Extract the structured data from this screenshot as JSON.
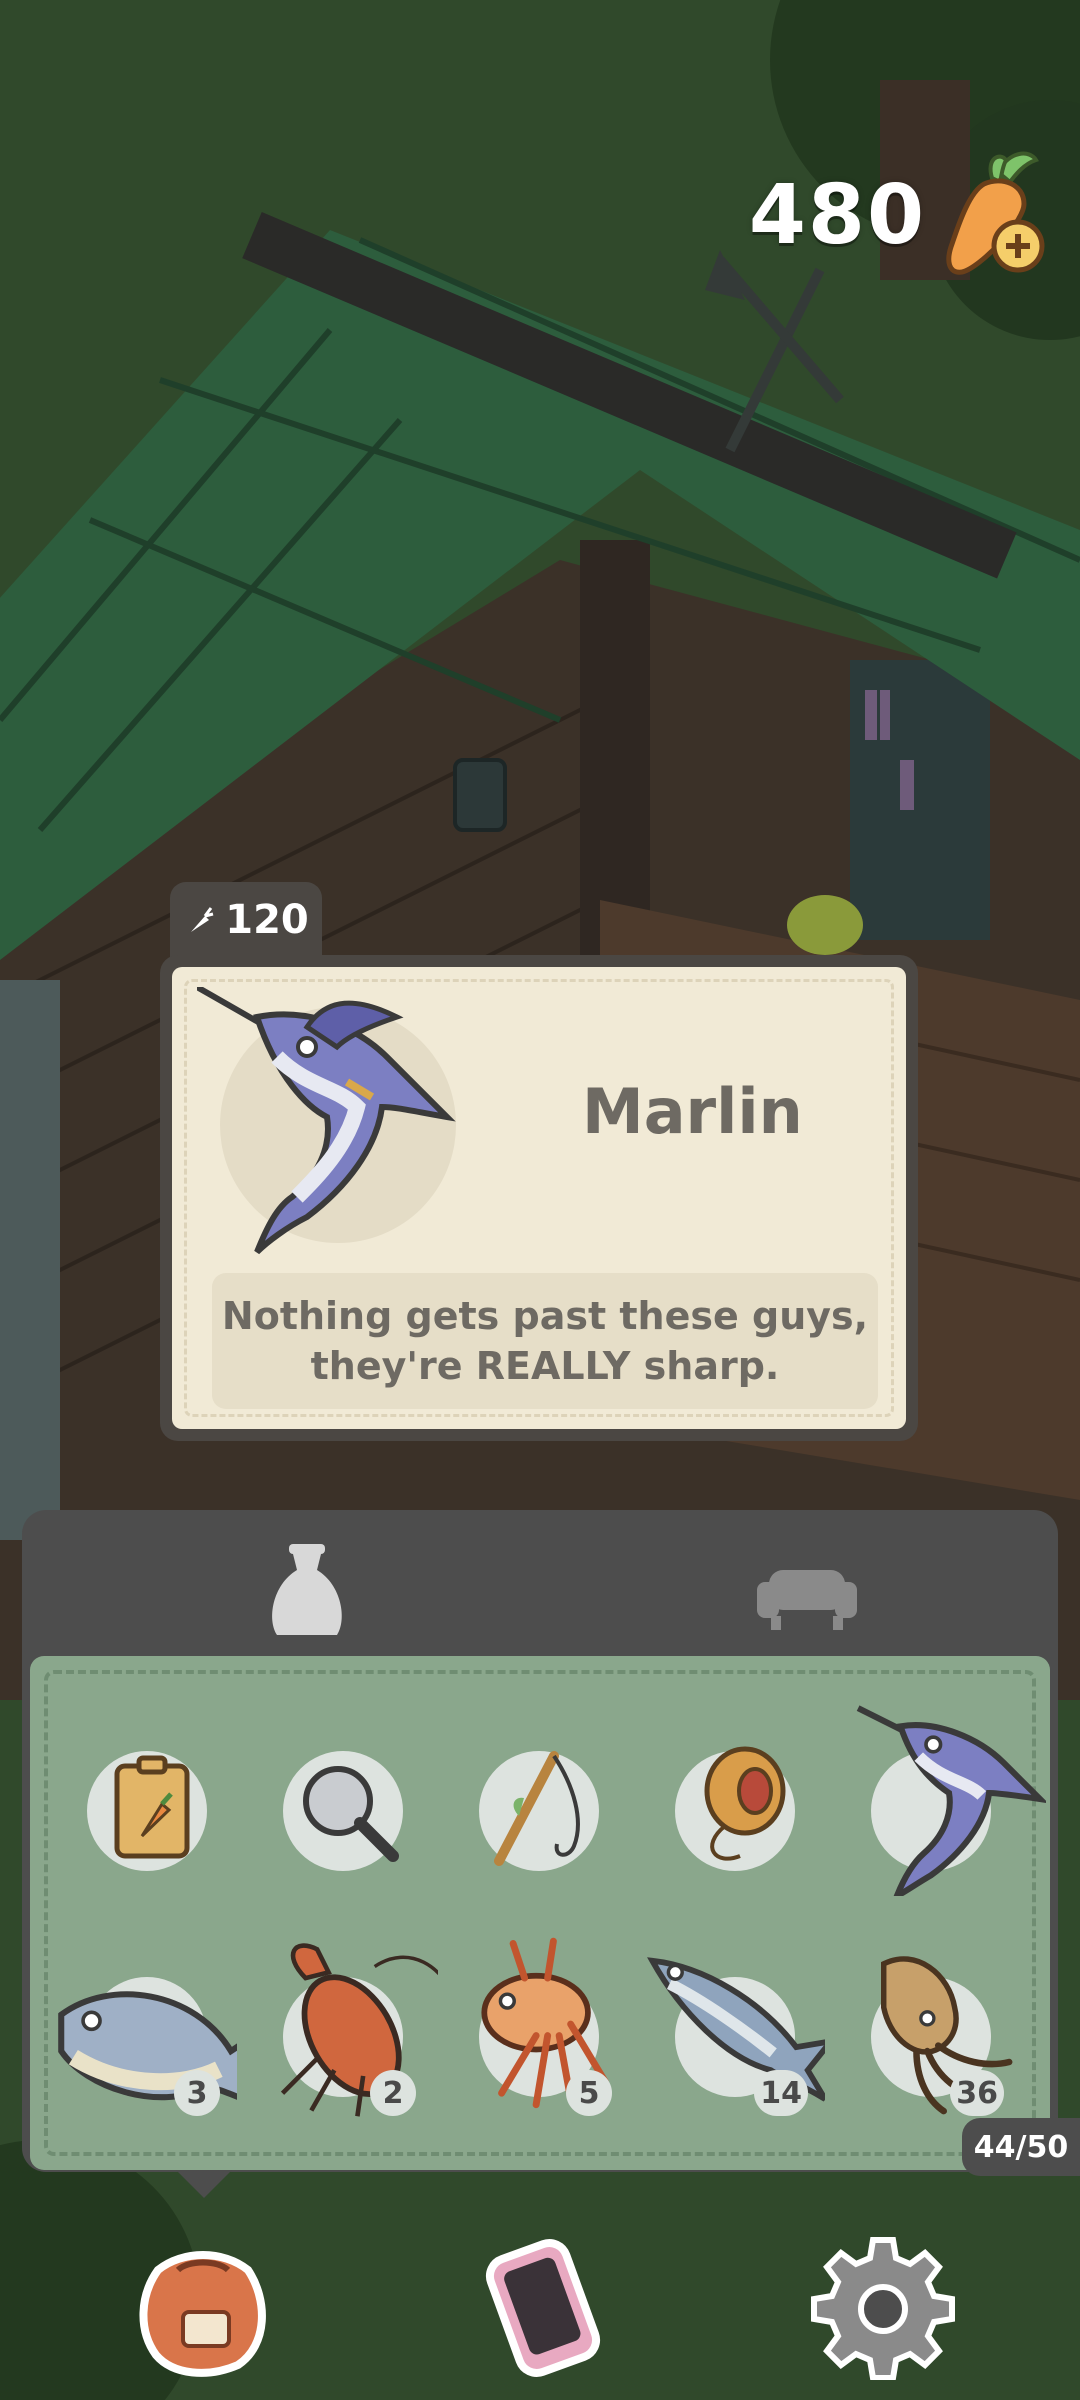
{
  "currency": {
    "amount": "480",
    "icon": "carrot-plus-icon"
  },
  "tooltip": {
    "price": "120",
    "price_icon": "carrot-icon",
    "item_name": "Marlin",
    "description": "Nothing gets past these guys,\nthey're REALLY sharp."
  },
  "inventory": {
    "tabs": [
      {
        "icon": "bag-icon",
        "selected": true
      },
      {
        "icon": "furniture-icon",
        "selected": false
      }
    ],
    "slots": [
      {
        "item": "carrot-seed-packet",
        "count": ""
      },
      {
        "item": "magnifying-glass",
        "count": ""
      },
      {
        "item": "fishing-rod",
        "count": ""
      },
      {
        "item": "yo-yo",
        "count": ""
      },
      {
        "item": "marlin",
        "count": ""
      },
      {
        "item": "tuna",
        "count": "3"
      },
      {
        "item": "lobster",
        "count": "2"
      },
      {
        "item": "lionfish",
        "count": "5"
      },
      {
        "item": "mackerel",
        "count": "14"
      },
      {
        "item": "squid",
        "count": "36"
      }
    ],
    "capacity": "44/50"
  },
  "nav": [
    {
      "icon": "inventory-bag-icon"
    },
    {
      "icon": "phone-icon"
    },
    {
      "icon": "settings-gear-icon"
    }
  ],
  "colors": {
    "panel_dark": "#4d4d4d",
    "panel_green": "#8aa78c",
    "tooltip_cream": "#f1ead6"
  }
}
